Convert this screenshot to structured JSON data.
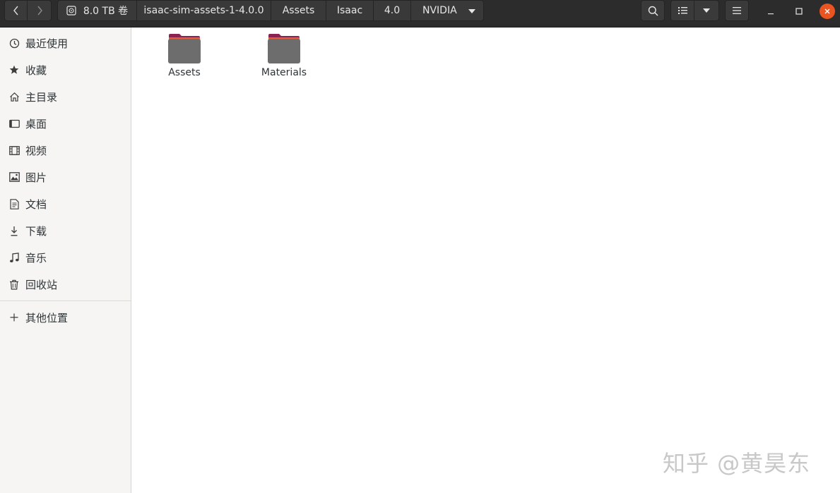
{
  "header": {
    "breadcrumbs": [
      {
        "label": "8.0 TB 卷",
        "icon": "drive-icon"
      },
      {
        "label": "isaac-sim-assets-1-4.0.0"
      },
      {
        "label": "Assets"
      },
      {
        "label": "Isaac"
      },
      {
        "label": "4.0"
      },
      {
        "label": "NVIDIA"
      }
    ]
  },
  "sidebar": {
    "items": [
      {
        "label": "最近使用",
        "icon": "clock-icon"
      },
      {
        "label": "收藏",
        "icon": "star-icon"
      },
      {
        "label": "主目录",
        "icon": "home-icon"
      },
      {
        "label": "桌面",
        "icon": "desktop-icon"
      },
      {
        "label": "视频",
        "icon": "video-icon"
      },
      {
        "label": "图片",
        "icon": "image-icon"
      },
      {
        "label": "文档",
        "icon": "document-icon"
      },
      {
        "label": "下载",
        "icon": "download-icon"
      },
      {
        "label": "音乐",
        "icon": "music-icon"
      },
      {
        "label": "回收站",
        "icon": "trash-icon"
      }
    ],
    "other_locations": {
      "label": "其他位置",
      "icon": "plus-icon"
    }
  },
  "main": {
    "folders": [
      {
        "name": "Assets"
      },
      {
        "name": "Materials"
      }
    ]
  },
  "watermark": "知乎 @黄昊东",
  "colors": {
    "headerbar": "#2c2c2c",
    "sidebar_bg": "#f6f5f4",
    "close_button": "#e95420",
    "folder_body": "#6d6d6d",
    "folder_tab": "#8b2252"
  }
}
